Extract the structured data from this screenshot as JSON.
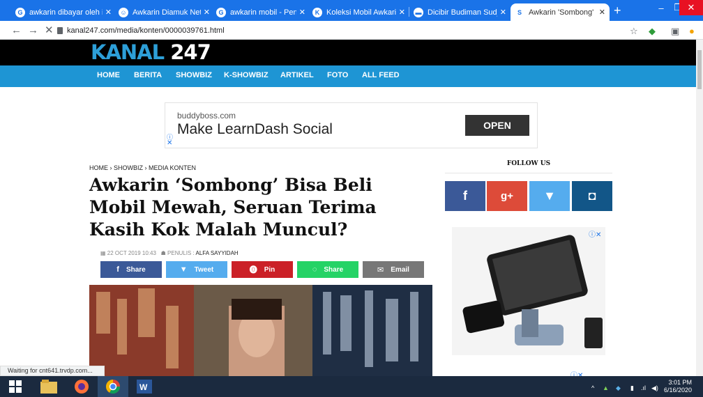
{
  "browser": {
    "tabs": [
      {
        "title": "awkarin dibayar oleh iph",
        "favicon": "G"
      },
      {
        "title": "Awkarin Diamuk Netizen",
        "favicon": "☺"
      },
      {
        "title": "awkarin mobil - Penelus",
        "favicon": "G"
      },
      {
        "title": "Koleksi Mobil Awkarin, S",
        "favicon": "K"
      },
      {
        "title": "Dicibir Budiman Sudjatm",
        "favicon": "▬"
      },
      {
        "title": "Awkarin 'Sombong' Bisa",
        "favicon": "S"
      }
    ],
    "new_tab": "+",
    "url": "kanal247.com/media/konten/0000039761.html",
    "status": "Waiting for cnt641.trvdp.com..."
  },
  "site": {
    "logo_word": "KANAL",
    "logo_num": "247",
    "nav": [
      "HOME",
      "BERITA",
      "SHOWBIZ",
      "K-SHOWBIZ",
      "ARTIKEL",
      "FOTO",
      "ALL FEED"
    ]
  },
  "ad": {
    "domain": "buddyboss.com",
    "headline": "Make LearnDash Social",
    "cta": "OPEN"
  },
  "article": {
    "breadcrumb": [
      "HOME",
      "SHOWBIZ",
      "MEDIA KONTEN"
    ],
    "title": "Awkarin ‘Sombong’ Bisa Beli Mobil Mewah, Seruan Terima Kasih Kok Malah Muncul?",
    "date": "22 OCT 2019 10:43",
    "author_label": "PENULIS :",
    "author": "ALFA SAYYIDAH",
    "share": [
      {
        "label": "Share",
        "icon": "facebook-icon",
        "glyph": "f",
        "color": "#3b5998"
      },
      {
        "label": "Tweet",
        "icon": "twitter-icon",
        "glyph": "🐦",
        "color": "#55acee"
      },
      {
        "label": "Pin",
        "icon": "pinterest-icon",
        "glyph": "℗",
        "color": "#cb2027"
      },
      {
        "label": "Share",
        "icon": "whatsapp-icon",
        "glyph": "✆",
        "color": "#25d366"
      },
      {
        "label": "Email",
        "icon": "email-icon",
        "glyph": "✉",
        "color": "#777777"
      }
    ]
  },
  "sidebar": {
    "follow_title": "FOLLOW US",
    "social": [
      {
        "icon": "facebook-icon",
        "glyph": "f",
        "color": "#3b5998"
      },
      {
        "icon": "google-plus-icon",
        "glyph": "g+",
        "color": "#dd4b39"
      },
      {
        "icon": "twitter-icon",
        "glyph": "🐦",
        "color": "#55acee"
      },
      {
        "icon": "instagram-icon",
        "glyph": "◘",
        "color": "#125688"
      }
    ]
  },
  "taskbar": {
    "time": "3:01 PM",
    "date": "6/16/2020"
  }
}
